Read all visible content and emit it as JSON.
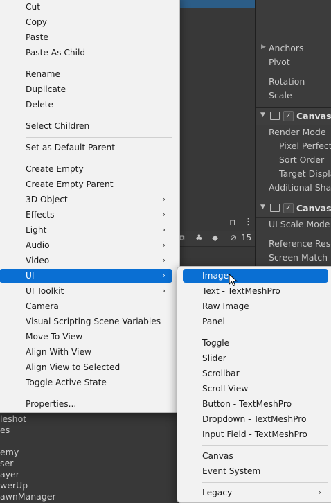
{
  "inspector": {
    "rows": [
      "Anchors",
      "Pivot",
      "Rotation",
      "Scale"
    ],
    "canvas_title": "Canvas",
    "canvas_rows": [
      "Render Mode",
      "Pixel Perfect",
      "Sort Order",
      "Target Displa",
      "Additional Shade"
    ],
    "scaler_title": "Canvas S",
    "scaler_rows": [
      "UI Scale Mode",
      "Reference Reso",
      "Screen Match M"
    ]
  },
  "hierarchy": {
    "visibility_count": "15",
    "items": [
      "leshot",
      "es",
      "emy",
      "ser",
      "ayer",
      "werUp",
      "awnManager"
    ]
  },
  "context_menu": {
    "groups": [
      [
        "Cut",
        "Copy",
        "Paste",
        "Paste As Child"
      ],
      [
        "Rename",
        "Duplicate",
        "Delete"
      ],
      [
        "Select Children"
      ],
      [
        "Set as Default Parent"
      ],
      [
        "Create Empty",
        "Create Empty Parent",
        "3D Object",
        "Effects",
        "Light",
        "Audio",
        "Video",
        "UI",
        "UI Toolkit",
        "Camera",
        "Visual Scripting Scene Variables",
        "Move To View",
        "Align With View",
        "Align View to Selected",
        "Toggle Active State"
      ],
      [
        "Properties..."
      ]
    ],
    "submenu_items": [
      "3D Object",
      "Effects",
      "Light",
      "Audio",
      "Video",
      "UI",
      "UI Toolkit"
    ],
    "selected": "UI"
  },
  "ui_submenu": {
    "groups": [
      [
        "Image",
        "Text - TextMeshPro",
        "Raw Image",
        "Panel"
      ],
      [
        "Toggle",
        "Slider",
        "Scrollbar",
        "Scroll View",
        "Button - TextMeshPro",
        "Dropdown - TextMeshPro",
        "Input Field - TextMeshPro"
      ],
      [
        "Canvas",
        "Event System"
      ],
      [
        "Legacy"
      ]
    ],
    "submenu_items": [
      "Legacy"
    ],
    "selected": "Image"
  },
  "colors": {
    "accent": "#0a6fd3",
    "menu_bg": "#f2f2f2",
    "editor_bg": "#383838"
  }
}
